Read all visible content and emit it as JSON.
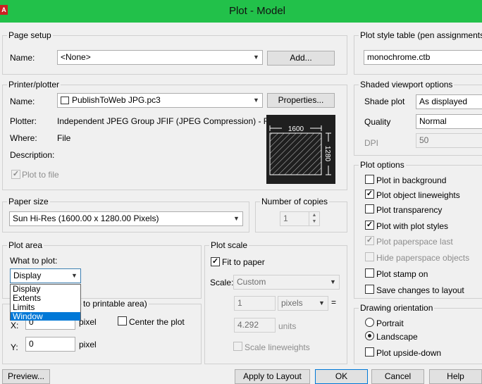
{
  "title": "Plot - Model",
  "app_icon": "A",
  "page_setup": {
    "group": "Page setup",
    "name_label": "Name:",
    "name_value": "<None>",
    "add_button": "Add..."
  },
  "printer": {
    "group": "Printer/plotter",
    "name_label": "Name:",
    "name_value": "PublishToWeb JPG.pc3",
    "properties_button": "Properties...",
    "plotter_label": "Plotter:",
    "plotter_value": "Independent JPEG Group JFIF (JPEG Compression) - Ra...",
    "where_label": "Where:",
    "where_value": "File",
    "description_label": "Description:",
    "plot_to_file": "Plot to file",
    "preview_width": "1600",
    "preview_height": "1280"
  },
  "paper_size": {
    "group": "Paper size",
    "value": "Sun Hi-Res (1600.00 x 1280.00 Pixels)"
  },
  "copies": {
    "group": "Number of copies",
    "value": "1"
  },
  "plot_area": {
    "group": "Plot area",
    "what_label": "What to plot:",
    "selected": "Display",
    "options": [
      "Display",
      "Extents",
      "Limits",
      "Window"
    ]
  },
  "plot_offset": {
    "group_suffix": "to printable area)",
    "x_label": "X:",
    "x_value": "0",
    "y_label": "Y:",
    "y_value": "0",
    "unit": "pixel",
    "center": "Center the plot"
  },
  "plot_scale": {
    "group": "Plot scale",
    "fit": "Fit to paper",
    "scale_label": "Scale:",
    "scale_value": "Custom",
    "v1": "1",
    "unit1": "pixels",
    "v2": "4.292",
    "unit2": "units",
    "eq": "=",
    "lineweights": "Scale lineweights"
  },
  "pen": {
    "group": "Plot style table (pen assignments)",
    "value": "monochrome.ctb"
  },
  "shaded": {
    "group": "Shaded viewport options",
    "shade_label": "Shade plot",
    "shade_value": "As displayed",
    "quality_label": "Quality",
    "quality_value": "Normal",
    "dpi_label": "DPI",
    "dpi_value": "50"
  },
  "options": {
    "group": "Plot options",
    "items": [
      "Plot in background",
      "Plot object lineweights",
      "Plot transparency",
      "Plot with plot styles",
      "Plot paperspace last",
      "Hide paperspace objects",
      "Plot stamp on",
      "Save changes to layout"
    ]
  },
  "orientation": {
    "group": "Drawing orientation",
    "portrait": "Portrait",
    "landscape": "Landscape",
    "upside": "Plot upside-down"
  },
  "bottom": {
    "preview": "Preview...",
    "apply": "Apply to Layout",
    "ok": "OK",
    "cancel": "Cancel",
    "help": "Help"
  }
}
